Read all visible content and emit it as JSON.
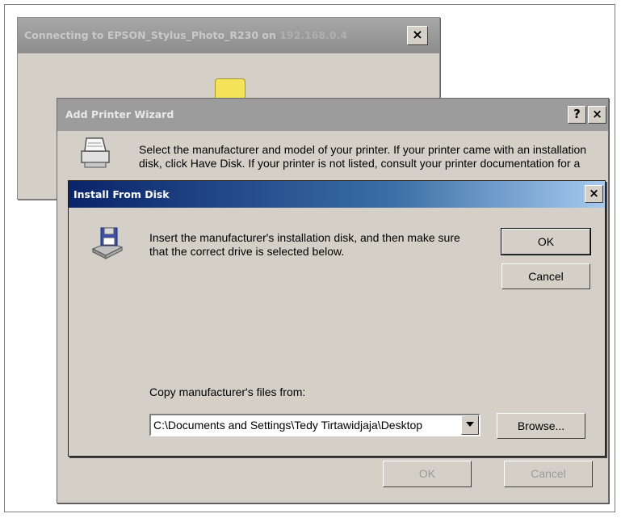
{
  "connect_dialog": {
    "title_prefix": "Connecting to EPSON_Stylus_Photo_R230 on ",
    "title_ip": "192.168.0.4",
    "close_glyph": "×"
  },
  "wizard": {
    "title": "Add Printer Wizard",
    "help_glyph": "?",
    "close_glyph": "×",
    "intro_text": "Select the manufacturer and model of your printer. If your printer came with an installation disk, click Have Disk. If your printer is not listed, consult your printer documentation for a compatible printer.",
    "ok_label": "OK",
    "cancel_label": "Cancel"
  },
  "install_dialog": {
    "title": "Install From Disk",
    "close_glyph": "×",
    "message": "Insert the manufacturer's installation disk, and then make sure that the correct drive is selected below.",
    "ok_label": "OK",
    "cancel_label": "Cancel",
    "copy_label": "Copy manufacturer's files from:",
    "path_value": "C:\\Documents and Settings\\Tedy Tirtawidjaja\\Desktop",
    "browse_label": "Browse..."
  },
  "icons": {
    "folder": "folder-icon",
    "printer": "printer-icon",
    "disk": "floppy-disk-drive-icon",
    "dropdown": "chevron-down-icon"
  }
}
